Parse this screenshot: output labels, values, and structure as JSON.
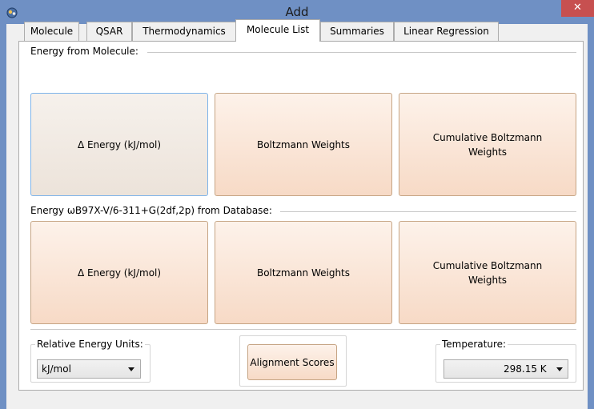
{
  "window": {
    "title": "Add",
    "close_glyph": "✕"
  },
  "tabs": [
    {
      "label": "Molecule"
    },
    {
      "label": "QSAR"
    },
    {
      "label": "Thermodynamics"
    },
    {
      "label": "Molecule List",
      "active": true
    },
    {
      "label": "Summaries"
    },
    {
      "label": "Linear Regression"
    }
  ],
  "group_molecule": {
    "header": "Energy from Molecule:",
    "buttons": [
      {
        "label": "Δ Energy (kJ/mol)"
      },
      {
        "label": "Boltzmann Weights"
      },
      {
        "label": "Cumulative Boltzmann Weights"
      }
    ]
  },
  "group_database": {
    "header": "Energy ωB97X-V/6-311+G(2df,2p) from Database:",
    "buttons": [
      {
        "label": "Δ Energy (kJ/mol)"
      },
      {
        "label": "Boltzmann Weights"
      },
      {
        "label": "Cumulative Boltzmann Weights"
      }
    ]
  },
  "relative_energy": {
    "legend": "Relative Energy Units:",
    "selected": "kJ/mol"
  },
  "alignment": {
    "label": "Alignment Scores"
  },
  "temperature": {
    "legend": "Temperature:",
    "selected": "298.15 K"
  },
  "icons": {
    "app": "app-icon",
    "close": "close-icon",
    "dropdown": "chevron-down-icon"
  },
  "colors": {
    "title_bar": "#6f90c4",
    "close_button": "#c75050",
    "button_fill": "#f7dac6",
    "focus_border": "#7eb4ea"
  }
}
